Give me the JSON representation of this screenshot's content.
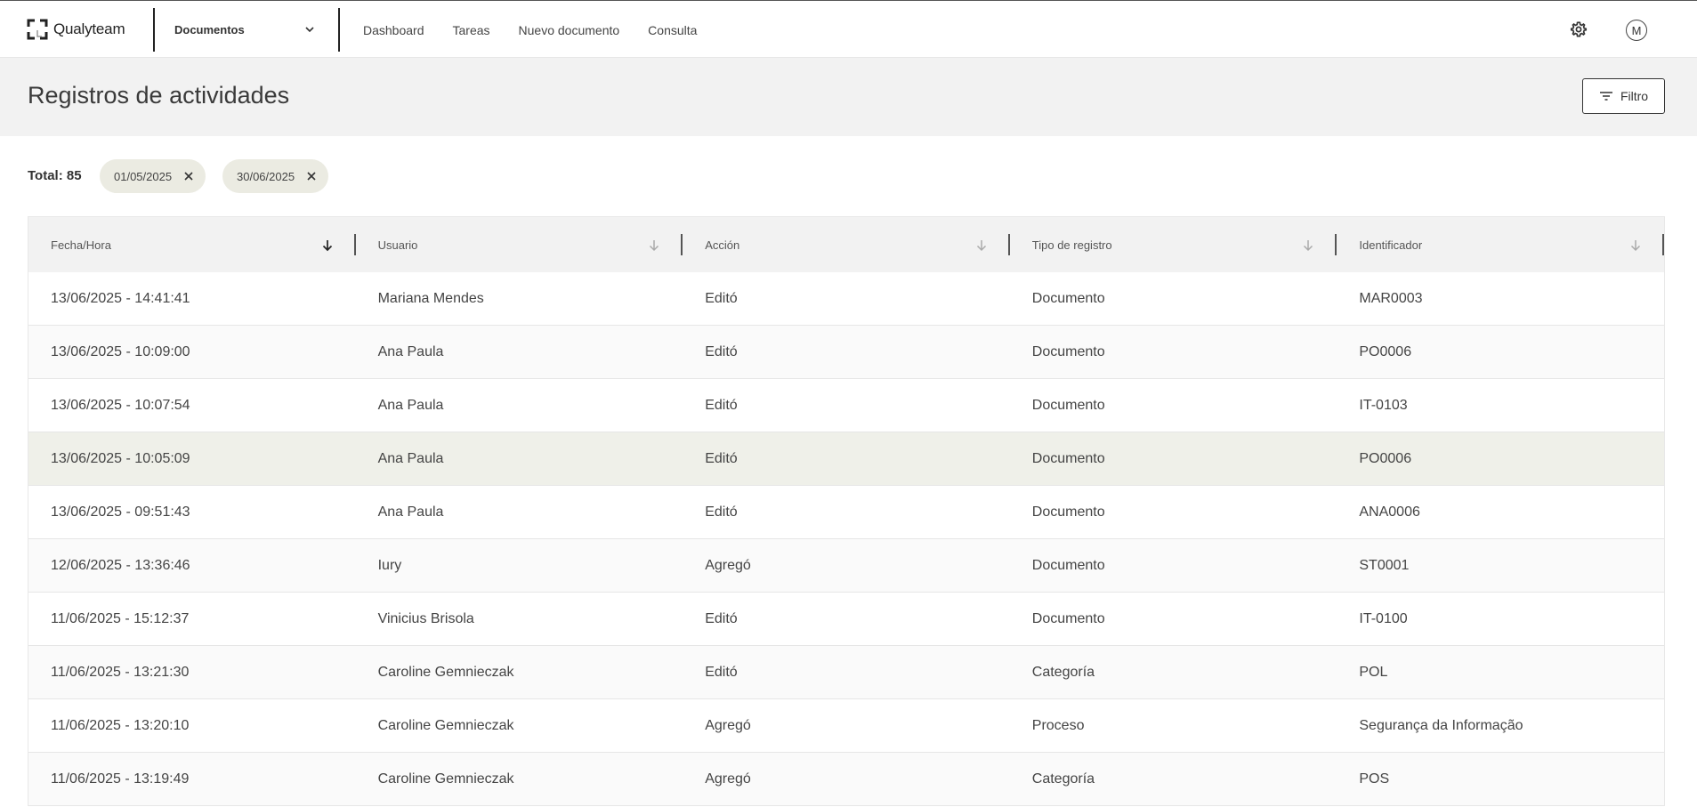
{
  "app": {
    "name": "Qualyteam",
    "module": "Documentos"
  },
  "nav": [
    "Dashboard",
    "Tareas",
    "Nuevo documento",
    "Consulta"
  ],
  "user": {
    "initial": "M"
  },
  "page": {
    "title": "Registros de actividades",
    "filter_label": "Filtro"
  },
  "summary": {
    "total_label": "Total: 85"
  },
  "chips": [
    {
      "label": "01/05/2025"
    },
    {
      "label": "30/06/2025"
    }
  ],
  "table": {
    "columns": [
      "Fecha/Hora",
      "Usuario",
      "Acción",
      "Tipo de registro",
      "Identificador"
    ],
    "sorted_column": "Fecha/Hora",
    "rows": [
      [
        "13/06/2025 - 14:41:41",
        "Mariana Mendes",
        "Editó",
        "Documento",
        "MAR0003"
      ],
      [
        "13/06/2025 - 10:09:00",
        "Ana Paula",
        "Editó",
        "Documento",
        "PO0006"
      ],
      [
        "13/06/2025 - 10:07:54",
        "Ana Paula",
        "Editó",
        "Documento",
        "IT-0103"
      ],
      [
        "13/06/2025 - 10:05:09",
        "Ana Paula",
        "Editó",
        "Documento",
        "PO0006"
      ],
      [
        "13/06/2025 - 09:51:43",
        "Ana Paula",
        "Editó",
        "Documento",
        "ANA0006"
      ],
      [
        "12/06/2025 - 13:36:46",
        "Iury",
        "Agregó",
        "Documento",
        "ST0001"
      ],
      [
        "11/06/2025 - 15:12:37",
        "Vinicius Brisola",
        "Editó",
        "Documento",
        "IT-0100"
      ],
      [
        "11/06/2025 - 13:21:30",
        "Caroline Gemnieczak",
        "Editó",
        "Categoría",
        "POL"
      ],
      [
        "11/06/2025 - 13:20:10",
        "Caroline Gemnieczak",
        "Agregó",
        "Proceso",
        "Segurança da Informação"
      ],
      [
        "11/06/2025 - 13:19:49",
        "Caroline Gemnieczak",
        "Agregó",
        "Categoría",
        "POS"
      ]
    ],
    "selected_row": 3
  },
  "icons": {
    "logo": "qualyteam-bracket-logo",
    "module_dropdown": "chevron-down-icon",
    "settings": "gear-icon",
    "filter": "filter-lines-icon",
    "chip_remove": "close-icon",
    "sort": "arrow-down-icon"
  },
  "colors": {
    "header_bg": "#f2f2f2",
    "chip_bg": "#ebebe2",
    "selected_row_bg": "#eff0e9",
    "text": "#333333"
  }
}
